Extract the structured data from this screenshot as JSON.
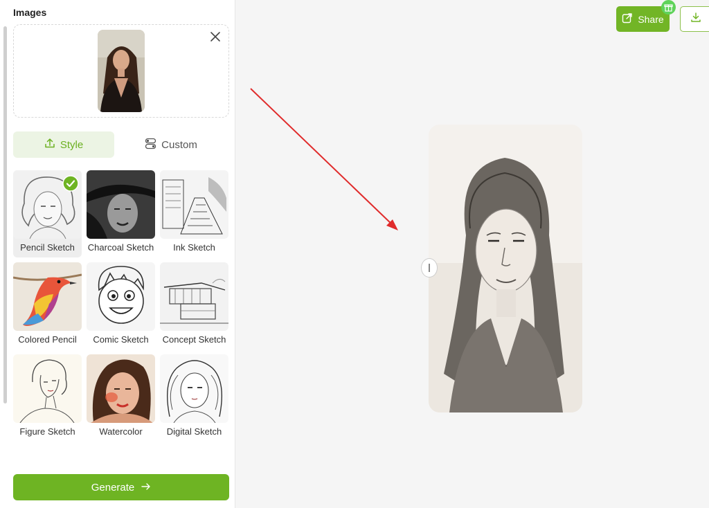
{
  "left_panel": {
    "images_title": "Images",
    "tabs": [
      {
        "label": "Style",
        "icon": "upload-icon",
        "active": true
      },
      {
        "label": "Custom",
        "icon": "toggle-icon",
        "active": false
      }
    ],
    "styles": [
      {
        "label": "Pencil Sketch",
        "selected": true
      },
      {
        "label": "Charcoal Sketch",
        "selected": false
      },
      {
        "label": "Ink Sketch",
        "selected": false
      },
      {
        "label": "Colored Pencil",
        "selected": false
      },
      {
        "label": "Comic Sketch",
        "selected": false
      },
      {
        "label": "Concept Sketch",
        "selected": false
      },
      {
        "label": "Figure Sketch",
        "selected": false
      },
      {
        "label": "Watercolor",
        "selected": false
      },
      {
        "label": "Digital Sketch",
        "selected": false
      }
    ],
    "generate_label": "Generate",
    "generate_icon": "arrow-right-icon"
  },
  "toolbar": {
    "share_label": "Share",
    "share_icon": "share-icon",
    "badge_icon": "gift-icon",
    "download_icon": "download-icon"
  },
  "colors": {
    "accent": "#6eb423",
    "accent_light": "#ecf4e4",
    "annotation_arrow": "#e02b2b"
  }
}
